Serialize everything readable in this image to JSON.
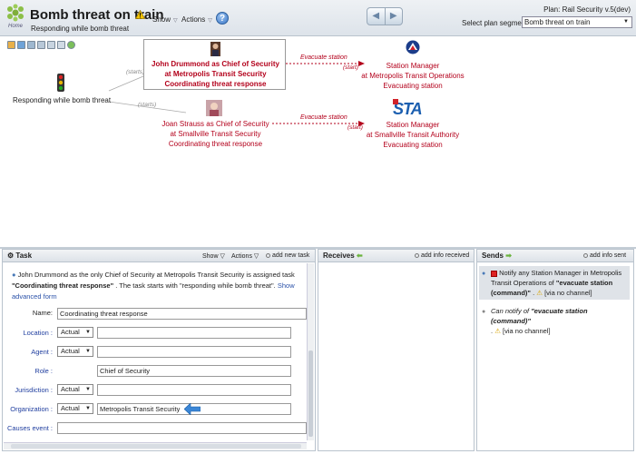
{
  "header": {
    "home_label": "Home",
    "title": "Bomb threat on train",
    "subtitle": "Responding while bomb threat",
    "show_menu": "Show",
    "actions_menu": "Actions",
    "help_glyph": "?",
    "plan_label": "Plan: Rail Security v.5(dev)",
    "segment_label": "Select plan segment:",
    "segment_value": "Bomb threat on train"
  },
  "diagram": {
    "event_label": "Responding while bomb threat",
    "starts_label": "(starts)",
    "start_label": "(start)",
    "part1": [
      "John Drummond as Chief of Security",
      "at Metropolis Transit Security",
      "Coordinating threat response"
    ],
    "part2": [
      "Joan Strauss as Chief of Security",
      "at Smallville Transit Security",
      "Coordinating threat response"
    ],
    "part3": [
      "Station Manager",
      "at Metropolis Transit Operations",
      "Evacuating station"
    ],
    "part4": [
      "Station Manager",
      "at Smallville Transit Authority",
      "Evacuating station"
    ],
    "flow_label": "Evacuate station",
    "sta_logo": "STA"
  },
  "task": {
    "title": "Task",
    "show": "Show",
    "actions": "Actions",
    "add_new": "add new task",
    "desc_pre": "John Drummond as the only Chief of Security at Metropolis Transit Security is assigned task",
    "desc_task": "\"Coordinating threat response\"",
    "desc_post": ". The task starts with \"responding while bomb threat\".",
    "show_link": "Show",
    "advanced_form": "advanced form",
    "fields": {
      "name_label": "Name:",
      "name_value": "Coordinating threat response",
      "location_label": "Location :",
      "agent_label": "Agent :",
      "role_label": "Role :",
      "role_value": "Chief of Security",
      "jurisdiction_label": "Jurisdiction :",
      "organization_label": "Organization :",
      "organization_value": "Metropolis Transit Security",
      "causes_label": "Causes event :",
      "actual": "Actual"
    }
  },
  "receives": {
    "title": "Receives",
    "add": "add info received"
  },
  "sends": {
    "title": "Sends",
    "add": "add info sent",
    "item1_pre": "Notify any Station Manager in Metropolis Transit Operations of",
    "item1_q": "\"evacuate station (command)\"",
    "item1_post": ".",
    "item1_channel": "[via no channel]",
    "item2_pre": "Can notify of",
    "item2_q": "\"evacuate station (command)\"",
    "item2_post": ".",
    "item2_channel": "[via no channel]"
  },
  "colors": {
    "accent_red": "#b3001b",
    "link_blue": "#2950a8"
  }
}
